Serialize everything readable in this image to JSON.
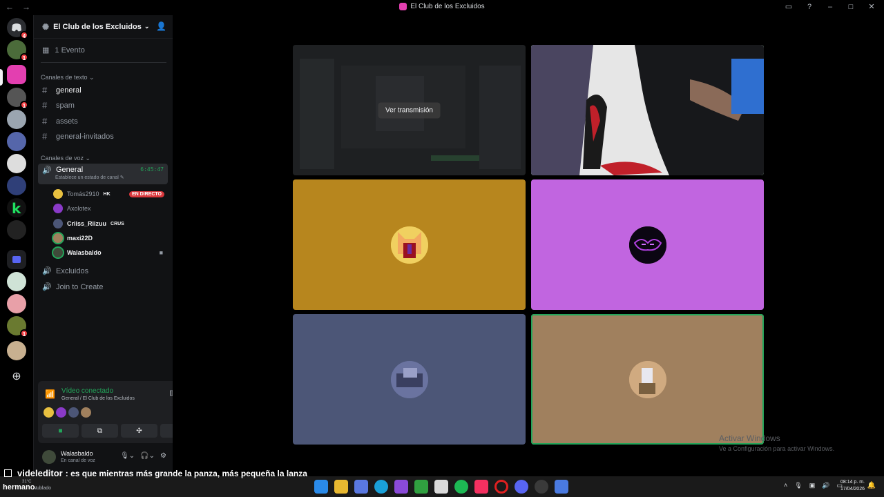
{
  "window": {
    "title": "El Club de los Excluidos",
    "nav_back": "←",
    "nav_forward": "→"
  },
  "server": {
    "name": "El Club de los Excluidos",
    "events_label": "1 Evento"
  },
  "text_channels": {
    "category": "Canales de texto",
    "items": [
      "general",
      "spam",
      "assets",
      "general-invitados"
    ]
  },
  "voice_channels": {
    "category": "Canales de voz",
    "active": {
      "name": "General",
      "timer": "6:45:47",
      "status_placeholder": "Establece un estado de canal"
    },
    "users": [
      {
        "name": "Tomás2910",
        "tag": "HK",
        "live": "EN DIRECTO"
      },
      {
        "name": "Axolotex"
      },
      {
        "name": "Criiss_Riizuu",
        "tag": "CRUS"
      },
      {
        "name": "maxi22D"
      },
      {
        "name": "Walasbaldo"
      }
    ],
    "others": [
      "Excluidos",
      "Join to Create"
    ]
  },
  "rtc": {
    "title": "Vídeo conectado",
    "subtitle": "General / El Club de los Excluidos"
  },
  "user_panel": {
    "name": "Walasbaldo",
    "status": "En canal de voz"
  },
  "stage": {
    "stream_button": "Ver transmisión"
  },
  "watermark": {
    "line1": "Activar Windows",
    "line2": "Ve a Configuración para activar Windows."
  },
  "caption": {
    "user": "videleditor",
    "text": ": es que mientras más grande la panza, más pequeña la lanza",
    "user2": "hermano"
  },
  "taskbar": {
    "weather_temp": "31°C",
    "weather_text": "Nublado",
    "time": "08:14 p. m.",
    "date": "17/04/2026"
  },
  "colors": {
    "speaking": "#23a55a",
    "live": "#da373c",
    "tile_orange": "#b7861e",
    "tile_purple": "#c165e0",
    "tile_slate": "#4c5677",
    "tile_tan": "#a0805e"
  }
}
